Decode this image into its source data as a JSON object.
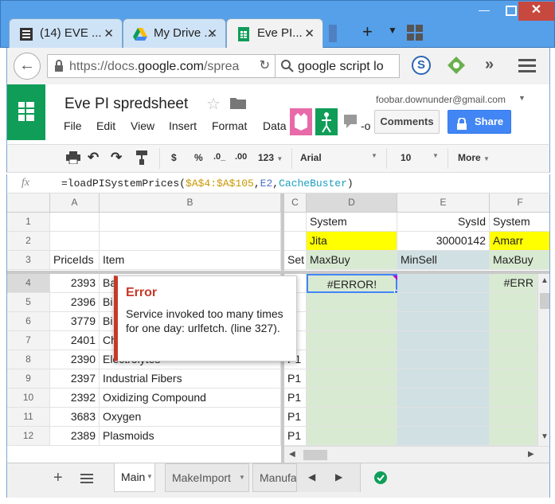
{
  "browser": {
    "tabs": [
      {
        "label": "(14) EVE ...",
        "icon": "list-icon"
      },
      {
        "label": "My Drive ...",
        "icon": "drive-icon"
      },
      {
        "label": "Eve PI...",
        "icon": "sheets-icon"
      }
    ],
    "url_prefix": "https://docs.",
    "url_domain": "google.com",
    "url_suffix": "/sprea",
    "search_text": "google script lo"
  },
  "doc": {
    "title": "Eve PI spredsheet",
    "account": "foobar.downunder@gmail.com",
    "menus": [
      "File",
      "Edit",
      "View",
      "Insert",
      "Format",
      "Data"
    ],
    "menu_overflow": "-o",
    "comments_label": "Comments",
    "share_label": "Share"
  },
  "toolbar": {
    "currency": "$",
    "percent": "%",
    "dec_less": ".0_",
    "dec_more": ".00",
    "number_format": "123",
    "font": "Arial",
    "size": "10",
    "more": "More"
  },
  "formula": {
    "fx": "fx",
    "text_start": "=loadPISystemPrices(",
    "arg1": "$A$4:$A$105",
    "comma1": ",",
    "arg2": "E2",
    "comma2": ",",
    "arg3": "CacheBuster",
    "text_end": ")"
  },
  "columns": [
    "A",
    "B",
    "C",
    "D",
    "E",
    "F"
  ],
  "rows": [
    {
      "n": "1",
      "a": "",
      "b": "",
      "c": "",
      "d": "System",
      "e": "SysId",
      "f": "System"
    },
    {
      "n": "2",
      "a": "",
      "b": "",
      "c": "",
      "d": "Jita",
      "e": "30000142",
      "f": "Amarr"
    },
    {
      "n": "3",
      "a": "PriceIds",
      "b": "Item",
      "c": "Set",
      "d": "MaxBuy",
      "e": "MinSell",
      "f": "MaxBuy"
    },
    {
      "n": "4",
      "a": "2393",
      "b": "Ba",
      "c": "",
      "d": "#ERROR!",
      "e": "",
      "f": "#ERR"
    },
    {
      "n": "5",
      "a": "2396",
      "b": "Bi",
      "c": "",
      "d": "",
      "e": "",
      "f": ""
    },
    {
      "n": "6",
      "a": "3779",
      "b": "Bi",
      "c": "",
      "d": "",
      "e": "",
      "f": ""
    },
    {
      "n": "7",
      "a": "2401",
      "b": "Ch",
      "c": "",
      "d": "",
      "e": "",
      "f": ""
    },
    {
      "n": "8",
      "a": "2390",
      "b": "Electrolytes",
      "c": "P1",
      "d": "",
      "e": "",
      "f": ""
    },
    {
      "n": "9",
      "a": "2397",
      "b": "Industrial Fibers",
      "c": "P1",
      "d": "",
      "e": "",
      "f": ""
    },
    {
      "n": "10",
      "a": "2392",
      "b": "Oxidizing Compound",
      "c": "P1",
      "d": "",
      "e": "",
      "f": ""
    },
    {
      "n": "11",
      "a": "3683",
      "b": "Oxygen",
      "c": "P1",
      "d": "",
      "e": "",
      "f": ""
    },
    {
      "n": "12",
      "a": "2389",
      "b": "Plasmoids",
      "c": "P1",
      "d": "",
      "e": "",
      "f": ""
    }
  ],
  "error_popup": {
    "title": "Error",
    "message": "Service invoked too many times for one day: urlfetch. (line 327)."
  },
  "sheets": [
    "Main",
    "MakeImport",
    "Manufa"
  ],
  "colors": {
    "jita_yellow": "#ffff00",
    "maxbuy_green": "#d9ead3",
    "minsell_blue": "#d0e0e3",
    "sheets_green": "#0f9d58",
    "share_blue": "#4285f4",
    "error_red": "#c53929"
  }
}
